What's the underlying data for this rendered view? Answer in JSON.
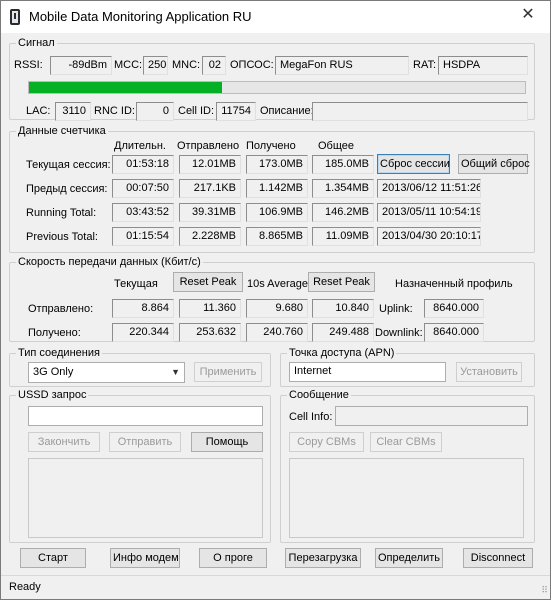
{
  "window": {
    "title": "Mobile Data Monitoring Application RU",
    "close_glyph": "✕"
  },
  "signal": {
    "group_label": "Сигнал",
    "rssi_label": "RSSI:",
    "rssi_value": "-89dBm",
    "mcc_label": "MCC:",
    "mcc_value": "250",
    "mnc_label": "MNC:",
    "mnc_value": "02",
    "operator_label": "ОПСОС:",
    "operator_value": "MegaFon RUS",
    "rat_label": "RAT:",
    "rat_value": "HSDPA",
    "signal_strength_fraction": 0.39,
    "lac_label": "LAC:",
    "lac_value": "3110",
    "rnc_label": "RNC ID:",
    "rnc_value": "0",
    "cell_label": "Cell ID:",
    "cell_value": "11754",
    "desc_label": "Описание:",
    "desc_value": ""
  },
  "counter": {
    "group_label": "Данные счетчика",
    "headers": [
      "Длительн.",
      "Отправлено",
      "Получено",
      "Общее"
    ],
    "rows": [
      {
        "label": "Текущая сессия:",
        "cells": [
          "01:53:18",
          "12.01MB",
          "173.0MB",
          "185.0MB"
        ],
        "extra": ""
      },
      {
        "label": "Предыд сессия:",
        "cells": [
          "00:07:50",
          "217.1KB",
          "1.142MB",
          "1.354MB"
        ],
        "extra": "2013/06/12 11:51:26"
      },
      {
        "label": "Running Total:",
        "cells": [
          "03:43:52",
          "39.31MB",
          "106.9MB",
          "146.2MB"
        ],
        "extra": "2013/05/11 10:54:19"
      },
      {
        "label": "Previous Total:",
        "cells": [
          "01:15:54",
          "2.228MB",
          "8.865MB",
          "11.09MB"
        ],
        "extra": "2013/04/30 20:10:17"
      }
    ],
    "reset_session": "Сброс сессии",
    "reset_total": "Общий сброс"
  },
  "speed": {
    "group_label": "Скорость передачи данных (Кбит/с)",
    "current_label": "Текущая",
    "reset_peak": "Reset Peak",
    "avg_label": "10s Average",
    "reset_peak2": "Reset Peak",
    "profile_label": "Назначенный профиль",
    "sent_label": "Отправлено:",
    "recv_label": "Получено:",
    "sent": [
      "8.864",
      "11.360",
      "9.680",
      "10.840"
    ],
    "recv": [
      "220.344",
      "253.632",
      "240.760",
      "249.488"
    ],
    "uplink_label": "Uplink:",
    "uplink_value": "8640.000",
    "downlink_label": "Downlink:",
    "downlink_value": "8640.000"
  },
  "connection": {
    "group_label": "Тип соединения",
    "selected": "3G Only",
    "apply": "Применить"
  },
  "apn": {
    "group_label": "Точка доступа (APN)",
    "value": "Internet",
    "set": "Установить"
  },
  "ussd": {
    "group_label": "USSD запрос",
    "input_value": "",
    "finish": "Закончить",
    "send": "Отправить",
    "help": "Помощь"
  },
  "message": {
    "group_label": "Сообщение",
    "cellinfo_label": "Cell Info:",
    "cellinfo_value": "",
    "copy": "Copy CBMs",
    "clear": "Clear CBMs"
  },
  "bottom": [
    "Старт",
    "Инфо модем",
    "О проге",
    "Перезагрузка",
    "Определить",
    "Disconnect"
  ],
  "status": {
    "text": "Ready"
  }
}
